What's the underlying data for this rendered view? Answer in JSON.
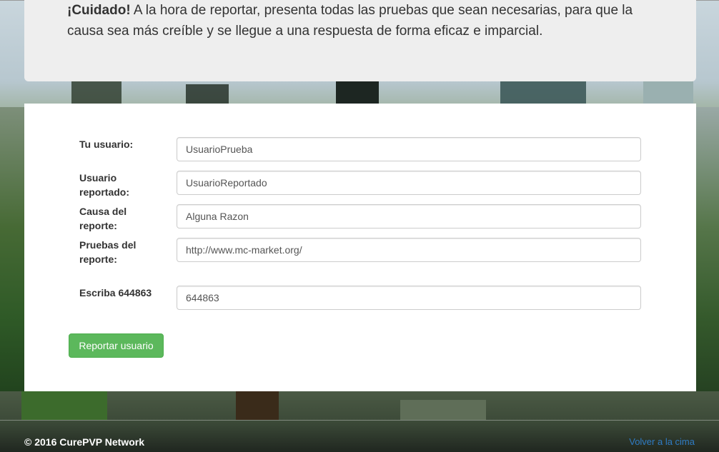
{
  "notice": {
    "strong": "¡Cuidado!",
    "text": " A la hora de reportar, presenta todas las pruebas que sean necesarias, para que la causa sea más creíble y se llegue a una respuesta de forma eficaz e imparcial."
  },
  "form": {
    "fields": [
      {
        "label": "Tu usuario:",
        "value": "UsuarioPrueba"
      },
      {
        "label": "Usuario reportado:",
        "value": "UsuarioReportado"
      },
      {
        "label": "Causa del reporte:",
        "value": "Alguna Razon"
      },
      {
        "label": "Pruebas del reporte:",
        "value": "http://www.mc-market.org/"
      },
      {
        "label": "Escriba 644863",
        "value": "644863"
      }
    ],
    "submit_label": "Reportar usuario"
  },
  "footer": {
    "copyright": "© 2016 CurePVP Network",
    "back_to_top": "Volver a la cima"
  },
  "colors": {
    "button": "#5cb85c",
    "link": "#2f7bc4"
  }
}
